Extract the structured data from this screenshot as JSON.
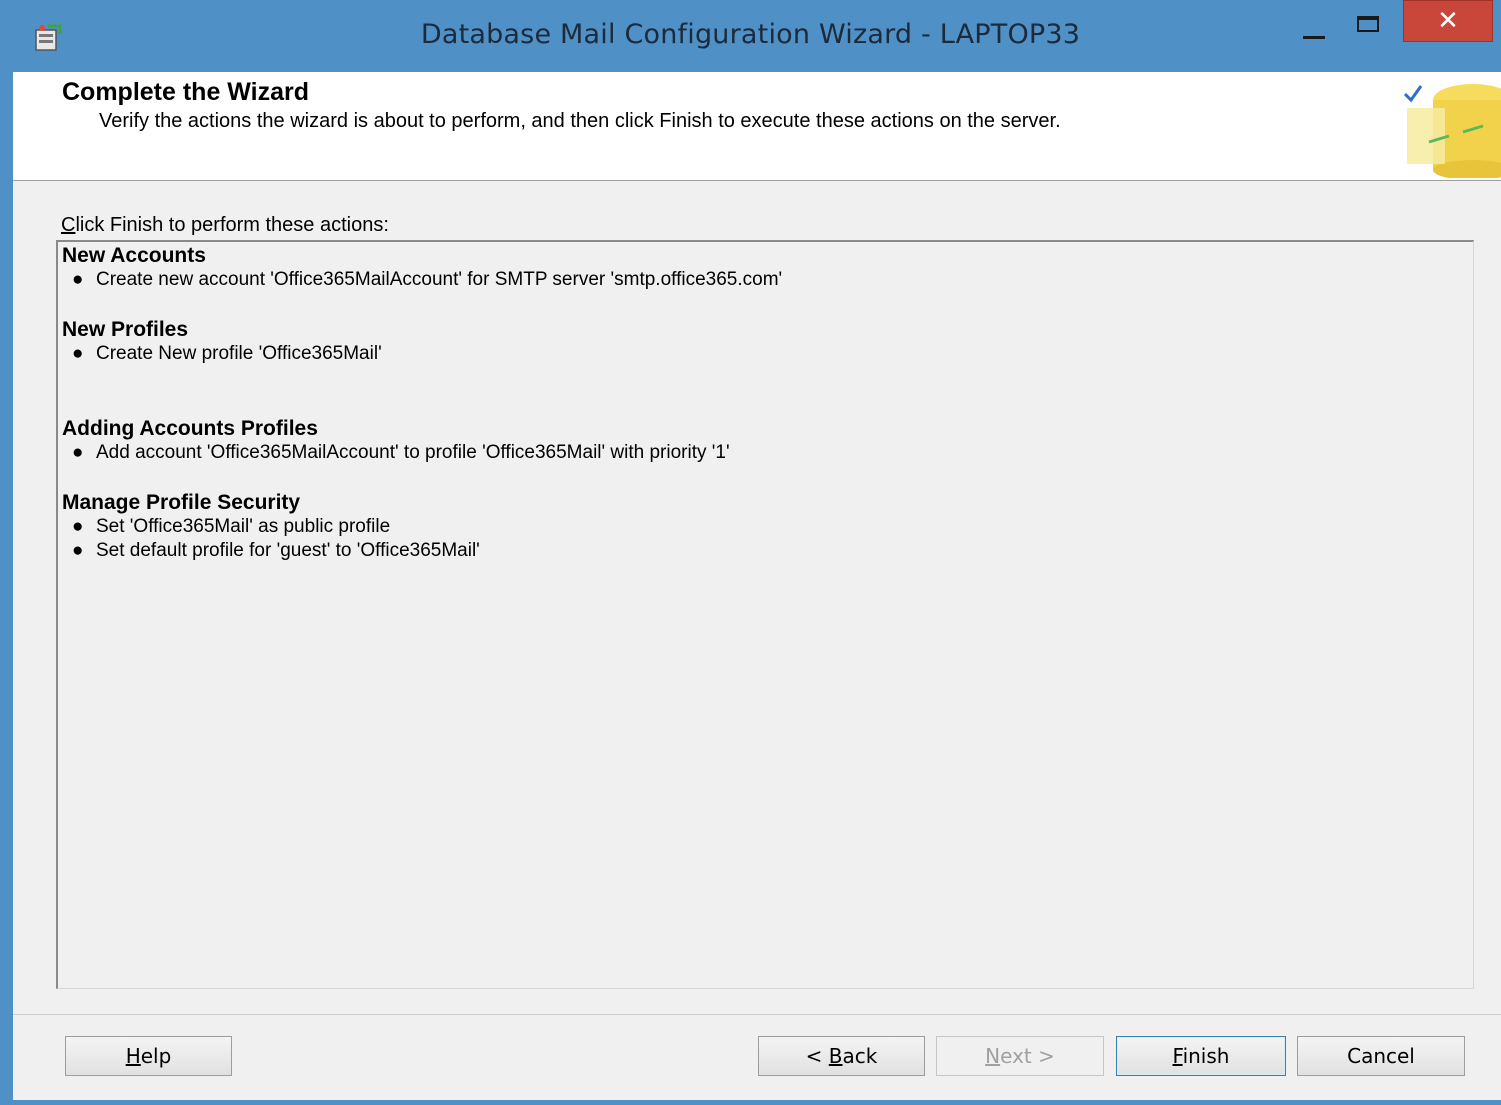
{
  "window": {
    "title": "Database Mail Configuration Wizard - LAPTOP33",
    "icons": {
      "app": "wizard-app-icon",
      "close": "close-icon",
      "minimize": "minimize-icon",
      "maximize": "maximize-icon"
    },
    "close_glyph": "✕"
  },
  "header": {
    "title": "Complete the Wizard",
    "description": "Verify the actions the wizard is about to perform, and then click Finish to execute these actions on the server.",
    "graphic": "database-checkmark-graphic"
  },
  "actions": {
    "label_mnemonic": "C",
    "label_rest": "lick Finish to perform these actions:",
    "sections": [
      {
        "heading": "New Accounts",
        "items": [
          "Create new account 'Office365MailAccount' for SMTP server 'smtp.office365.com'"
        ]
      },
      {
        "heading": "New Profiles",
        "items": [
          "Create New profile 'Office365Mail'"
        ]
      },
      {
        "heading": "Adding Accounts Profiles",
        "items": [
          "Add account 'Office365MailAccount' to profile 'Office365Mail' with priority '1'"
        ]
      },
      {
        "heading": "Manage Profile Security",
        "items": [
          "Set 'Office365Mail' as public profile",
          "Set default profile for 'guest' to 'Office365Mail'"
        ]
      }
    ],
    "bullet": "●"
  },
  "buttons": {
    "help": {
      "mnemonic": "H",
      "rest": "elp"
    },
    "back": {
      "prefix": "< ",
      "mnemonic": "B",
      "rest": "ack"
    },
    "next": {
      "mnemonic": "N",
      "rest": "ext >",
      "enabled": false
    },
    "finish": {
      "mnemonic": "F",
      "rest": "inish"
    },
    "cancel": {
      "label": "Cancel"
    }
  },
  "colors": {
    "titlebar": "#4f90c6",
    "close": "#c8463a",
    "client": "#f0f0f0",
    "finish_border": "#3c7fb1"
  }
}
